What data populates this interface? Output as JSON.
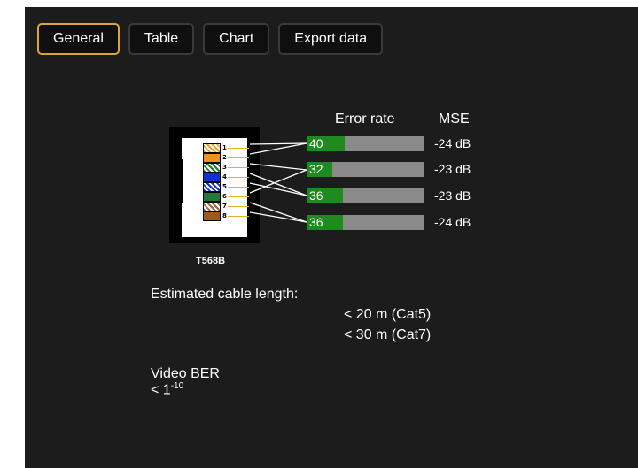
{
  "tabs": [
    {
      "label": "General",
      "active": true
    },
    {
      "label": "Table",
      "active": false
    },
    {
      "label": "Chart",
      "active": false
    },
    {
      "label": "Export data",
      "active": false
    }
  ],
  "columns": {
    "error_rate": "Error rate",
    "mse": "MSE"
  },
  "connector": {
    "standard": "T568B",
    "pins": [
      {
        "number": "1",
        "wire": "white-orange"
      },
      {
        "number": "2",
        "wire": "orange"
      },
      {
        "number": "3",
        "wire": "white-green"
      },
      {
        "number": "4",
        "wire": "blue"
      },
      {
        "number": "5",
        "wire": "white-blue"
      },
      {
        "number": "6",
        "wire": "green"
      },
      {
        "number": "7",
        "wire": "white-brown"
      },
      {
        "number": "8",
        "wire": "brown"
      }
    ]
  },
  "pairs": [
    {
      "error_rate": 40,
      "mse": "-24 dB",
      "fill_fraction": 0.32
    },
    {
      "error_rate": 32,
      "mse": "-23 dB",
      "fill_fraction": 0.22
    },
    {
      "error_rate": 36,
      "mse": "-23 dB",
      "fill_fraction": 0.31
    },
    {
      "error_rate": 36,
      "mse": "-24 dB",
      "fill_fraction": 0.31
    }
  ],
  "cable_length": {
    "label": "Estimated cable length:",
    "cat5": "< 20 m (Cat5)",
    "cat7": "< 30 m (Cat7)"
  },
  "ber": {
    "label": "Video BER",
    "base": "< 1",
    "exponent": "-10"
  },
  "colors": {
    "accent": "#d9a63c",
    "panel": "#1c1c1c",
    "bar_fill": "#1f8a1f",
    "bar_track": "#8a8a8a"
  }
}
